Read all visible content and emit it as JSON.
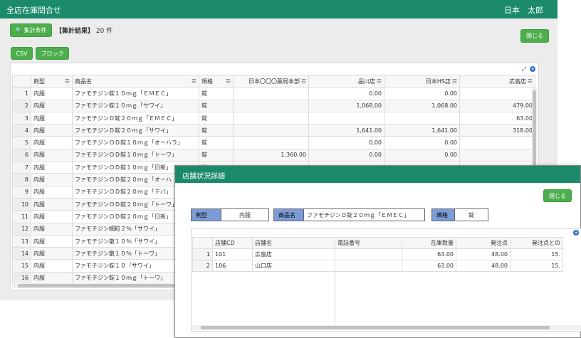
{
  "main": {
    "title": "全店在庫問合せ",
    "user": "日本　太郎",
    "search_button": "集計条件",
    "result_prefix": "【集計結果】",
    "result_count": "20 件",
    "close_button": "閉じる",
    "csv_button": "CSV",
    "block_button": "ブロック",
    "columns": [
      "剤型",
      "商品名",
      "規格",
      "日本〇〇〇薬局本部",
      "品川店",
      "日本HS店",
      "広島店"
    ],
    "rows": [
      {
        "no": "1",
        "type": "内服",
        "name": "ファモチジン錠１０ｍｇ「ＥＭＥＣ」",
        "spec": "錠",
        "c1": "",
        "c2": "0.00",
        "c3": "0.00",
        "c4": ""
      },
      {
        "no": "2",
        "type": "内服",
        "name": "ファモチジン錠１０ｍｇ「サワイ」",
        "spec": "錠",
        "c1": "",
        "c2": "1,068.00",
        "c3": "1,068.00",
        "c4": "479.00"
      },
      {
        "no": "3",
        "type": "内服",
        "name": "ファモチジンＤ錠２０ｍｇ「ＥＭＥＣ」",
        "spec": "錠",
        "c1": "",
        "c2": "",
        "c3": "",
        "c4": "63.00"
      },
      {
        "no": "4",
        "type": "内服",
        "name": "ファモチジンＤ錠２０ｍｇ「サワイ」",
        "spec": "錠",
        "c1": "",
        "c2": "1,641.00",
        "c3": "1,641.00",
        "c4": "318.00"
      },
      {
        "no": "5",
        "type": "内服",
        "name": "ファモチジンＯＤ錠１０ｍｇ「オーハラ」",
        "spec": "錠",
        "c1": "",
        "c2": "0.00",
        "c3": "0.00",
        "c4": ""
      },
      {
        "no": "6",
        "type": "内服",
        "name": "ファモチジンＯＤ錠１０ｍｇ「トーワ」",
        "spec": "錠",
        "c1": "1,360.00",
        "c2": "0.00",
        "c3": "0.00",
        "c4": ""
      },
      {
        "no": "7",
        "type": "内服",
        "name": "ファモチジンＯＤ錠１０ｍｇ「日新」",
        "spec": "錠",
        "c1": "",
        "c2": "",
        "c3": "",
        "c4": ""
      },
      {
        "no": "8",
        "type": "内服",
        "name": "ファモチジンＯＤ錠２０ｍｇ「オーハ",
        "spec": "",
        "c1": "",
        "c2": "",
        "c3": "",
        "c4": ""
      },
      {
        "no": "9",
        "type": "内服",
        "name": "ファモチジンＯＤ錠２０ｍｇ「テバ」",
        "spec": "",
        "c1": "",
        "c2": "",
        "c3": "",
        "c4": ""
      },
      {
        "no": "10",
        "type": "内服",
        "name": "ファモチジンＯＤ錠２０ｍｇ「トーワ」",
        "spec": "",
        "c1": "",
        "c2": "",
        "c3": "",
        "c4": ""
      },
      {
        "no": "11",
        "type": "内服",
        "name": "ファモチジンＯＤ錠２０ｍｇ「日新」",
        "spec": "",
        "c1": "",
        "c2": "",
        "c3": "",
        "c4": ""
      },
      {
        "no": "12",
        "type": "内服",
        "name": "ファモチジン細粒２％「サワイ」",
        "spec": "",
        "c1": "",
        "c2": "",
        "c3": "",
        "c4": ""
      },
      {
        "no": "13",
        "type": "内服",
        "name": "ファモチジン散１０％「サワイ」",
        "spec": "",
        "c1": "",
        "c2": "",
        "c3": "",
        "c4": ""
      },
      {
        "no": "14",
        "type": "内服",
        "name": "ファモチジン散１０％「トーワ」",
        "spec": "",
        "c1": "",
        "c2": "",
        "c3": "",
        "c4": ""
      },
      {
        "no": "15",
        "type": "内服",
        "name": "ファモチジン錠１０「サワイ」",
        "spec": "",
        "c1": "",
        "c2": "",
        "c3": "",
        "c4": ""
      },
      {
        "no": "16",
        "type": "内服",
        "name": "ファモチジン錠１０ｍｇ「トーワ」",
        "spec": "",
        "c1": "",
        "c2": "",
        "c3": "",
        "c4": ""
      }
    ]
  },
  "modal": {
    "title": "店舗状況詳細",
    "close_button": "閉じる",
    "type_label": "剤型",
    "type_value": "内服",
    "name_label": "商品名",
    "name_value": "ファモチジンＤ錠２０ｍｇ「ＥＭＥＣ」",
    "spec_label": "規格",
    "spec_value": "錠",
    "columns": [
      "店舗CD",
      "店舗名",
      "電話番号",
      "在庫数量",
      "発注点",
      "発注点との"
    ],
    "rows": [
      {
        "no": "1",
        "cd": "101",
        "store": "広島店",
        "tel": "",
        "qty": "63.00",
        "order": "48.00",
        "diff": "15."
      },
      {
        "no": "2",
        "cd": "106",
        "store": "山口店",
        "tel": "",
        "qty": "63.00",
        "order": "48.00",
        "diff": "15."
      }
    ]
  },
  "colors": {
    "header": "#1b8a6b",
    "button": "#4cae4c",
    "label": "#7b9cd6"
  }
}
